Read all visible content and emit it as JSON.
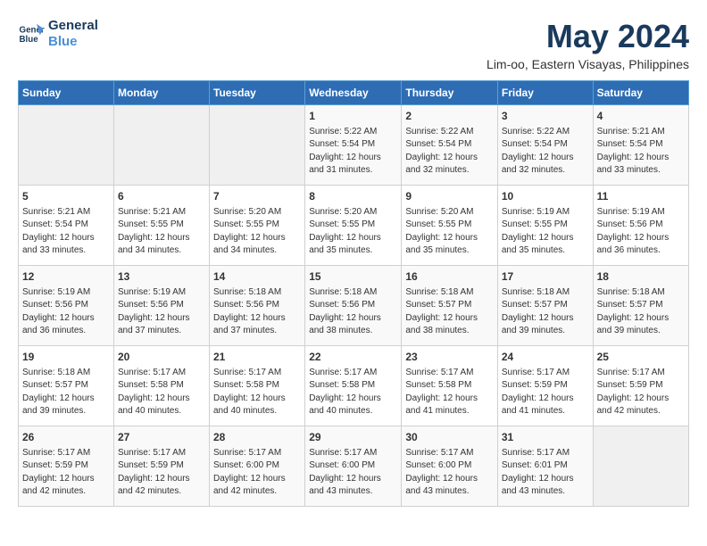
{
  "header": {
    "logo_line1": "General",
    "logo_line2": "Blue",
    "month_title": "May 2024",
    "location": "Lim-oo, Eastern Visayas, Philippines"
  },
  "weekdays": [
    "Sunday",
    "Monday",
    "Tuesday",
    "Wednesday",
    "Thursday",
    "Friday",
    "Saturday"
  ],
  "weeks": [
    [
      {
        "day": "",
        "empty": true
      },
      {
        "day": "",
        "empty": true
      },
      {
        "day": "",
        "empty": true
      },
      {
        "day": "1",
        "sunrise": "5:22 AM",
        "sunset": "5:54 PM",
        "daylight": "12 hours and 31 minutes."
      },
      {
        "day": "2",
        "sunrise": "5:22 AM",
        "sunset": "5:54 PM",
        "daylight": "12 hours and 32 minutes."
      },
      {
        "day": "3",
        "sunrise": "5:22 AM",
        "sunset": "5:54 PM",
        "daylight": "12 hours and 32 minutes."
      },
      {
        "day": "4",
        "sunrise": "5:21 AM",
        "sunset": "5:54 PM",
        "daylight": "12 hours and 33 minutes."
      }
    ],
    [
      {
        "day": "5",
        "sunrise": "5:21 AM",
        "sunset": "5:54 PM",
        "daylight": "12 hours and 33 minutes."
      },
      {
        "day": "6",
        "sunrise": "5:21 AM",
        "sunset": "5:55 PM",
        "daylight": "12 hours and 34 minutes."
      },
      {
        "day": "7",
        "sunrise": "5:20 AM",
        "sunset": "5:55 PM",
        "daylight": "12 hours and 34 minutes."
      },
      {
        "day": "8",
        "sunrise": "5:20 AM",
        "sunset": "5:55 PM",
        "daylight": "12 hours and 35 minutes."
      },
      {
        "day": "9",
        "sunrise": "5:20 AM",
        "sunset": "5:55 PM",
        "daylight": "12 hours and 35 minutes."
      },
      {
        "day": "10",
        "sunrise": "5:19 AM",
        "sunset": "5:55 PM",
        "daylight": "12 hours and 35 minutes."
      },
      {
        "day": "11",
        "sunrise": "5:19 AM",
        "sunset": "5:56 PM",
        "daylight": "12 hours and 36 minutes."
      }
    ],
    [
      {
        "day": "12",
        "sunrise": "5:19 AM",
        "sunset": "5:56 PM",
        "daylight": "12 hours and 36 minutes."
      },
      {
        "day": "13",
        "sunrise": "5:19 AM",
        "sunset": "5:56 PM",
        "daylight": "12 hours and 37 minutes."
      },
      {
        "day": "14",
        "sunrise": "5:18 AM",
        "sunset": "5:56 PM",
        "daylight": "12 hours and 37 minutes."
      },
      {
        "day": "15",
        "sunrise": "5:18 AM",
        "sunset": "5:56 PM",
        "daylight": "12 hours and 38 minutes."
      },
      {
        "day": "16",
        "sunrise": "5:18 AM",
        "sunset": "5:57 PM",
        "daylight": "12 hours and 38 minutes."
      },
      {
        "day": "17",
        "sunrise": "5:18 AM",
        "sunset": "5:57 PM",
        "daylight": "12 hours and 39 minutes."
      },
      {
        "day": "18",
        "sunrise": "5:18 AM",
        "sunset": "5:57 PM",
        "daylight": "12 hours and 39 minutes."
      }
    ],
    [
      {
        "day": "19",
        "sunrise": "5:18 AM",
        "sunset": "5:57 PM",
        "daylight": "12 hours and 39 minutes."
      },
      {
        "day": "20",
        "sunrise": "5:17 AM",
        "sunset": "5:58 PM",
        "daylight": "12 hours and 40 minutes."
      },
      {
        "day": "21",
        "sunrise": "5:17 AM",
        "sunset": "5:58 PM",
        "daylight": "12 hours and 40 minutes."
      },
      {
        "day": "22",
        "sunrise": "5:17 AM",
        "sunset": "5:58 PM",
        "daylight": "12 hours and 40 minutes."
      },
      {
        "day": "23",
        "sunrise": "5:17 AM",
        "sunset": "5:58 PM",
        "daylight": "12 hours and 41 minutes."
      },
      {
        "day": "24",
        "sunrise": "5:17 AM",
        "sunset": "5:59 PM",
        "daylight": "12 hours and 41 minutes."
      },
      {
        "day": "25",
        "sunrise": "5:17 AM",
        "sunset": "5:59 PM",
        "daylight": "12 hours and 42 minutes."
      }
    ],
    [
      {
        "day": "26",
        "sunrise": "5:17 AM",
        "sunset": "5:59 PM",
        "daylight": "12 hours and 42 minutes."
      },
      {
        "day": "27",
        "sunrise": "5:17 AM",
        "sunset": "5:59 PM",
        "daylight": "12 hours and 42 minutes."
      },
      {
        "day": "28",
        "sunrise": "5:17 AM",
        "sunset": "6:00 PM",
        "daylight": "12 hours and 42 minutes."
      },
      {
        "day": "29",
        "sunrise": "5:17 AM",
        "sunset": "6:00 PM",
        "daylight": "12 hours and 43 minutes."
      },
      {
        "day": "30",
        "sunrise": "5:17 AM",
        "sunset": "6:00 PM",
        "daylight": "12 hours and 43 minutes."
      },
      {
        "day": "31",
        "sunrise": "5:17 AM",
        "sunset": "6:01 PM",
        "daylight": "12 hours and 43 minutes."
      },
      {
        "day": "",
        "empty": true
      }
    ]
  ],
  "labels": {
    "sunrise_prefix": "Sunrise: ",
    "sunset_prefix": "Sunset: ",
    "daylight_prefix": "Daylight: "
  }
}
